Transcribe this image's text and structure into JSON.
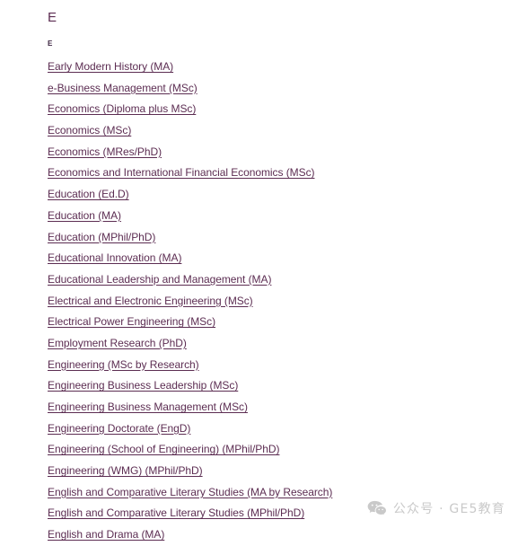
{
  "section": {
    "letter_heading": "E",
    "letter_sublabel": "E",
    "courses": [
      {
        "label": "Early Modern History (MA)"
      },
      {
        "label": "e-Business Management (MSc)"
      },
      {
        "label": "Economics (Diploma plus MSc)"
      },
      {
        "label": "Economics (MSc)"
      },
      {
        "label": "Economics (MRes/PhD)"
      },
      {
        "label": "Economics and International Financial Economics (MSc)"
      },
      {
        "label": "Education (Ed.D)"
      },
      {
        "label": "Education (MA)"
      },
      {
        "label": "Education (MPhil/PhD)"
      },
      {
        "label": "Educational Innovation (MA)"
      },
      {
        "label": "Educational Leadership and Management (MA)"
      },
      {
        "label": "Electrical and Electronic Engineering (MSc)"
      },
      {
        "label": "Electrical Power Engineering (MSc)"
      },
      {
        "label": "Employment Research (PhD)"
      },
      {
        "label": "Engineering (MSc by Research)"
      },
      {
        "label": "Engineering Business Leadership (MSc)"
      },
      {
        "label": "Engineering Business Management (MSc)"
      },
      {
        "label": "Engineering Doctorate (EngD)"
      },
      {
        "label": "Engineering (School of Engineering) (MPhil/PhD)"
      },
      {
        "label": "Engineering (WMG) (MPhil/PhD)"
      },
      {
        "label": "English and Comparative Literary Studies (MA by Research)"
      },
      {
        "label": "English and Comparative Literary Studies (MPhil/PhD)"
      },
      {
        "label": "English and Drama (MA)"
      }
    ]
  },
  "watermark": {
    "icon": "wechat-icon",
    "text": "公众号 · GE5教育"
  },
  "colors": {
    "link": "#5c2d52",
    "heading": "#5c2d52",
    "watermark": "#c9c9c9",
    "background": "#ffffff"
  }
}
